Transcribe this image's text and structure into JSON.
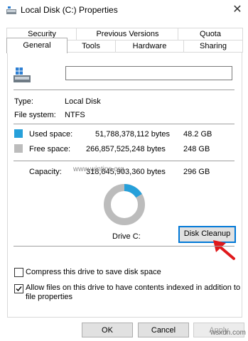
{
  "window": {
    "title": "Local Disk (C:) Properties",
    "close_glyph": "✕"
  },
  "tabs_row1": [
    "Security",
    "Previous Versions",
    "Quota"
  ],
  "tabs_row2": [
    "General",
    "Tools",
    "Hardware",
    "Sharing"
  ],
  "general": {
    "name_value": "",
    "type_label": "Type:",
    "type_value": "Local Disk",
    "fs_label": "File system:",
    "fs_value": "NTFS",
    "used_label": "Used space:",
    "used_bytes": "51,788,378,112 bytes",
    "used_gb": "48.2 GB",
    "free_label": "Free space:",
    "free_bytes": "266,857,525,248 bytes",
    "free_gb": "248 GB",
    "capacity_label": "Capacity:",
    "capacity_bytes": "318,645,903,360 bytes",
    "capacity_gb": "296 GB",
    "drive_label": "Drive C:",
    "cleanup_label": "Disk Cleanup",
    "used_fraction": 0.163,
    "colors": {
      "used": "#26a0da",
      "free": "#bcbcbc",
      "accent": "#0078d7"
    }
  },
  "options": {
    "compress_label": "Compress this drive to save disk space",
    "compress_checked": false,
    "index_label_line1": "Allow files on this drive to have contents indexed in addition to",
    "index_label_line2": "file properties",
    "index_checked": true
  },
  "buttons": {
    "ok": "OK",
    "cancel": "Cancel",
    "apply": "Apply"
  },
  "watermark": {
    "text": "www.wintips.org",
    "corner_text": "wsxdn.com"
  }
}
